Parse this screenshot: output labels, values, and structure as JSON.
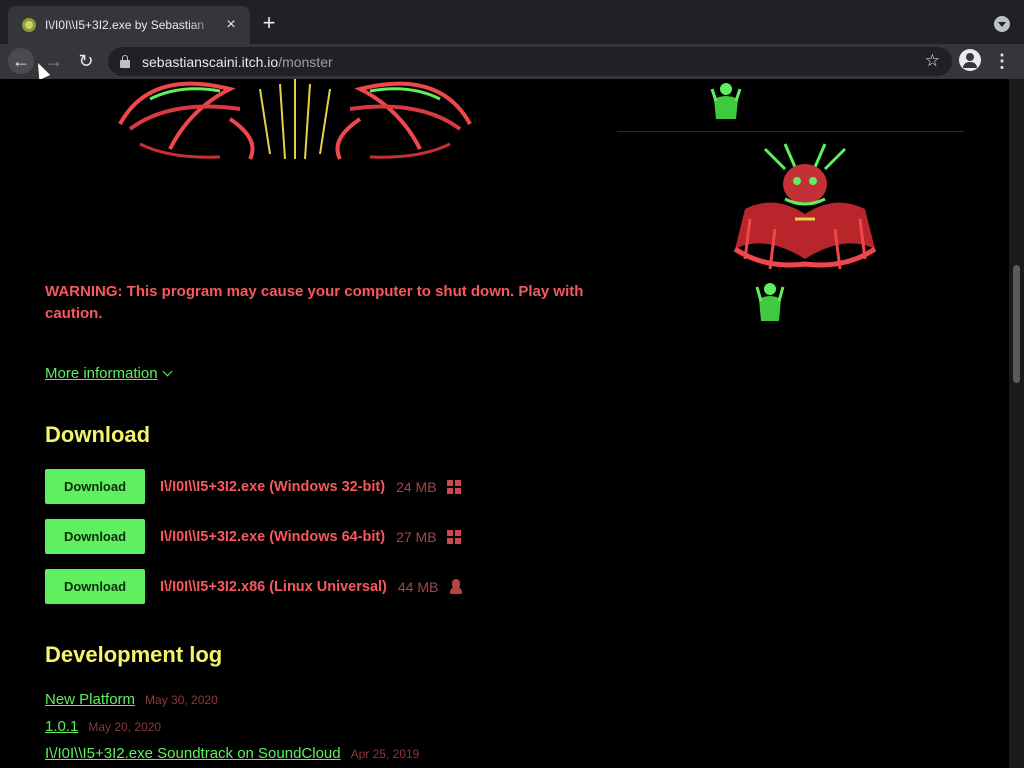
{
  "browser": {
    "tab_title": "I\\/I0I\\\\I5+3I2.exe by Sebastian",
    "url_host": "sebastianscaini.itch.io",
    "url_path": "/monster"
  },
  "page": {
    "warning": "WARNING: This program may cause your computer to shut down. Play with caution.",
    "more_info_label": "More information",
    "download_heading": "Download",
    "downloads": [
      {
        "button": "Download",
        "name": "I\\/I0I\\\\I5+3I2.exe (Windows 32-bit)",
        "size": "24 MB",
        "os_icon": "windows-icon"
      },
      {
        "button": "Download",
        "name": "I\\/I0I\\\\I5+3I2.exe (Windows 64-bit)",
        "size": "27 MB",
        "os_icon": "windows-icon"
      },
      {
        "button": "Download",
        "name": "I\\/I0I\\\\I5+3I2.x86 (Linux Universal)",
        "size": "44 MB",
        "os_icon": "linux-icon"
      }
    ],
    "devlog_heading": "Development log",
    "devlog": [
      {
        "title": "New Platform",
        "date": "May 30, 2020"
      },
      {
        "title": "1.0.1",
        "date": "May 20, 2020"
      },
      {
        "title": "I\\/I0I\\\\I5+3I2.exe Soundtrack on SoundCloud",
        "date": "Apr 25, 2019"
      }
    ]
  },
  "colors": {
    "accent_green": "#5ff05f",
    "heading_yellow": "#f4f46c",
    "warning_red": "#f7585c"
  }
}
